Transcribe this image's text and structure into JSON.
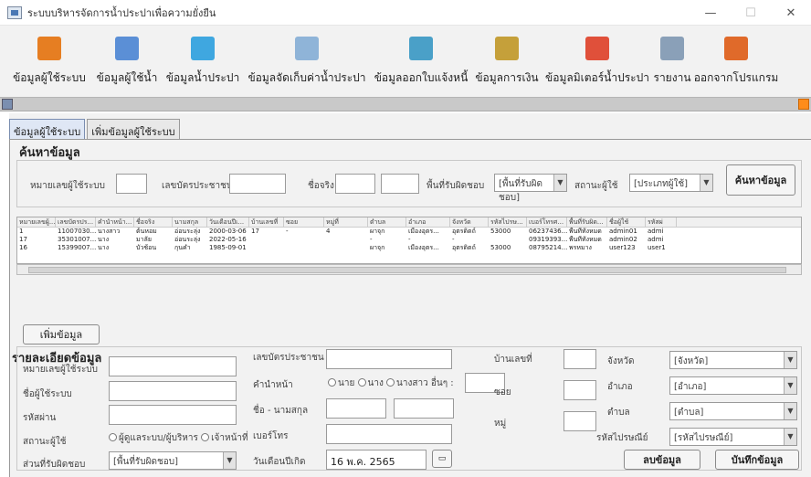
{
  "window": {
    "title": "ระบบบริหารจัดการน้ำประปาเพื่อความยั่งยืน",
    "min": "—",
    "max": "☐",
    "close": "✕"
  },
  "toolbar": [
    {
      "label": "ข้อมูลผู้ใช้ระบบ",
      "color": "#e67e22"
    },
    {
      "label": "ข้อมูลผู้ใช้น้ำ",
      "color": "#5b8fd6"
    },
    {
      "label": "ข้อมูลน้ำประปา",
      "color": "#3fa7e0"
    },
    {
      "label": "ข้อมูลจัดเก็บค่าน้ำประปา",
      "color": "#8fb4d8"
    },
    {
      "label": "ข้อมูลออกใบแจ้งหนี้",
      "color": "#4aa0c8"
    },
    {
      "label": "ข้อมูลการเงิน",
      "color": "#c5a03a"
    },
    {
      "label": "ข้อมูลมิเตอร์น้ำประปา",
      "color": "#e0503a"
    },
    {
      "label": "รายงาน",
      "color": "#8aa0b8"
    },
    {
      "label": "ออกจากโปรแกรม",
      "color": "#e06a2a"
    }
  ],
  "tabs": [
    "ข้อมูลผู้ใช้ระบบ",
    "เพิ่มข้อมูลผู้ใช้ระบบ"
  ],
  "search": {
    "heading": "ค้นหาข้อมูล",
    "user_no_label": "หมายเลขผู้ใช้ระบบ",
    "id_card_label": "เลขบัตรประชาชน",
    "firstname_label": "ชื่อจริง",
    "area_label": "พื้นที่รับผิดชอบ",
    "area_value": "[พื้นที่รับผิดชอบ]",
    "status_label": "สถานะผู้ใช้",
    "status_value": "[ประเภทผู้ใช้]",
    "button": "ค้นหาข้อมูล"
  },
  "table": {
    "columns": [
      "หมายเลขผู้...",
      "เลขบัตรปร...",
      "คำนำหน้า...",
      "ชื่อจริง",
      "นามสกุล",
      "วันเดือนปีเ...",
      "บ้านเลขที่",
      "ซอย",
      "หมู่ที่",
      "ตำบล",
      "อำเภอ",
      "จังหวัด",
      "รหัสไปรษ...",
      "เบอร์โทรศ...",
      "พื้นที่รับผิด...",
      "ชื่อผู้ใช้",
      "รหัสผ่"
    ],
    "rows": [
      [
        "1",
        "11007030...",
        "นางสาว",
        "ต้นหอม",
        "อ่อนระลุ่ง",
        "2000-03-06",
        "17",
        "-",
        "4",
        "ผาจุก",
        "เมืองอุตร...",
        "อุตรดิตถ์",
        "53000",
        "06237436...",
        "พื้นที่ทั้งหมด",
        "admin01",
        "admi"
      ],
      [
        "17",
        "35301007...",
        "นาง",
        "มาลัย",
        "อ่อนระลุ่ง",
        "2022-05-16",
        "",
        "",
        "",
        "-",
        "-",
        "-",
        "",
        "09319393...",
        "พื้นที่ทั้งหมด",
        "admin02",
        "admi"
      ],
      [
        "16",
        "15399007...",
        "นาง",
        "บัวช้อน",
        "กุนคำ",
        "1985-09-01",
        "",
        "",
        "",
        "ผาจุก",
        "เมืองอุตร...",
        "อุตรดิตถ์",
        "53000",
        "08795214...",
        "พรหมาง",
        "user123",
        "user1"
      ]
    ]
  },
  "add_button": "เพิ่มข้อมูล",
  "detail": {
    "heading": "รายละเอียดข้อมูล",
    "user_no": "หมายเลขผู้ใช้ระบบ",
    "username": "ชื่อผู้ใช้ระบบ",
    "password": "รหัสผ่าน",
    "status": "สถานะผู้ใช้",
    "status_opt1": "ผู้ดูแลระบบ/ผู้บริหาร",
    "status_opt2": "เจ้าหน้าที่",
    "area": "ส่วนที่รับผิดชอบ",
    "area_value": "[พื้นที่รับผิดชอบ]",
    "id_card": "เลขบัตรประชาชน",
    "prefix": "คำนำหน้า",
    "prefix_opts": [
      "นาย",
      "นาง",
      "นางสาว"
    ],
    "prefix_other": "อื่นๆ :",
    "fullname": "ชื่อ - นามสกุล",
    "phone": "เบอร์โทร",
    "birthdate": "วันเดือนปีเกิด",
    "birthdate_value": "16 พ.ค. 2565",
    "house_no": "บ้านเลขที่",
    "soi": "ซอย",
    "moo": "หมู่",
    "province": "จังหวัด",
    "province_value": "[จังหวัด]",
    "district": "อำเภอ",
    "district_value": "[อำเภอ]",
    "subdistrict": "ตำบล",
    "subdistrict_value": "[ตำบล]",
    "postcode": "รหัสไปรษณีย์",
    "postcode_value": "[รหัสไปรษณีย์]",
    "delete_button": "ลบข้อมูล",
    "save_button": "บันทึกข้อมูล"
  }
}
